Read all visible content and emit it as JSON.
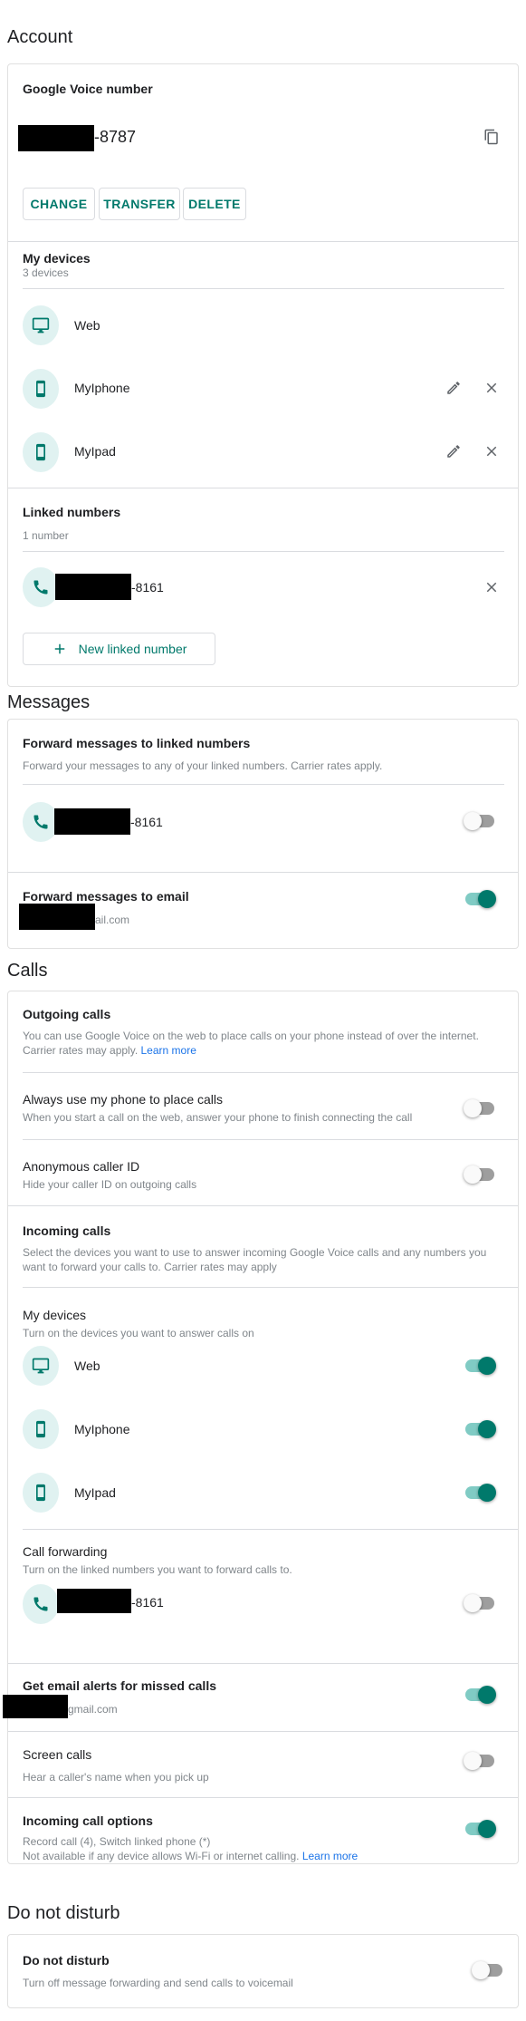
{
  "colors": {
    "accent": "#00796b",
    "icon_bg": "#e0f2f1",
    "toggle_on_track": "#80cbc4",
    "toggle_off_track": "#9e9e9e",
    "link": "#1a73e8"
  },
  "account": {
    "heading": "Account",
    "google_voice_number": {
      "title": "Google Voice number",
      "number_suffix": "-8787",
      "copy_icon": "copy-icon",
      "buttons": {
        "change": "CHANGE",
        "transfer": "TRANSFER",
        "delete": "DELETE"
      }
    },
    "my_devices": {
      "title": "My devices",
      "count": "3 devices",
      "items": [
        {
          "name": "Web",
          "icon": "monitor-icon",
          "editable": false
        },
        {
          "name": "MyIphone",
          "icon": "smartphone-icon",
          "editable": true
        },
        {
          "name": "MyIpad",
          "icon": "smartphone-icon",
          "editable": true
        }
      ]
    },
    "linked_numbers": {
      "title": "Linked numbers",
      "count": "1 number",
      "items": [
        {
          "number_suffix": "-8161",
          "icon": "phone-icon"
        }
      ],
      "new_button": "New linked number"
    }
  },
  "messages": {
    "heading": "Messages",
    "forward_to_linked": {
      "title": "Forward messages to linked numbers",
      "description": "Forward your messages to any of your linked numbers. Carrier rates apply.",
      "items": [
        {
          "number_suffix": "-8161",
          "enabled": false
        }
      ]
    },
    "forward_to_email": {
      "title": "Forward messages to email",
      "email_suffix": "ail.com",
      "enabled": true
    }
  },
  "calls": {
    "heading": "Calls",
    "outgoing": {
      "title": "Outgoing calls",
      "description": "You can use Google Voice on the web to place calls on your phone instead of over the internet. Carrier rates may apply.",
      "learn_more": "Learn more"
    },
    "always_use_phone": {
      "title": "Always use my phone to place calls",
      "description": "When you start a call on the web, answer your phone to finish connecting the call",
      "enabled": false
    },
    "anonymous_caller_id": {
      "title": "Anonymous caller ID",
      "description": "Hide your caller ID on outgoing calls",
      "enabled": false
    },
    "incoming": {
      "title": "Incoming calls",
      "description": "Select the devices you want to use to answer incoming Google Voice calls and any numbers you want to forward your calls to. Carrier rates may apply"
    },
    "my_devices": {
      "title": "My devices",
      "description": "Turn on the devices you want to answer calls on",
      "items": [
        {
          "name": "Web",
          "icon": "monitor-icon",
          "enabled": true
        },
        {
          "name": "MyIphone",
          "icon": "smartphone-icon",
          "enabled": true
        },
        {
          "name": "MyIpad",
          "icon": "smartphone-icon",
          "enabled": true
        }
      ]
    },
    "call_forwarding": {
      "title": "Call forwarding",
      "description": "Turn on the linked numbers you want to forward calls to.",
      "items": [
        {
          "number_suffix": "-8161",
          "enabled": false
        }
      ]
    },
    "email_alerts": {
      "title": "Get email alerts for missed calls",
      "email_suffix": "gmail.com",
      "enabled": true
    },
    "screen_calls": {
      "title": "Screen calls",
      "description": "Hear a caller's name when you pick up",
      "enabled": false
    },
    "incoming_call_options": {
      "title": "Incoming call options",
      "line1": "Record call (4), Switch linked phone (*)",
      "line2": "Not available if any device allows Wi-Fi or internet calling.",
      "learn_more": "Learn more",
      "enabled": true
    }
  },
  "do_not_disturb": {
    "heading": "Do not disturb",
    "title": "Do not disturb",
    "description": "Turn off message forwarding and send calls to voicemail",
    "enabled": false
  }
}
